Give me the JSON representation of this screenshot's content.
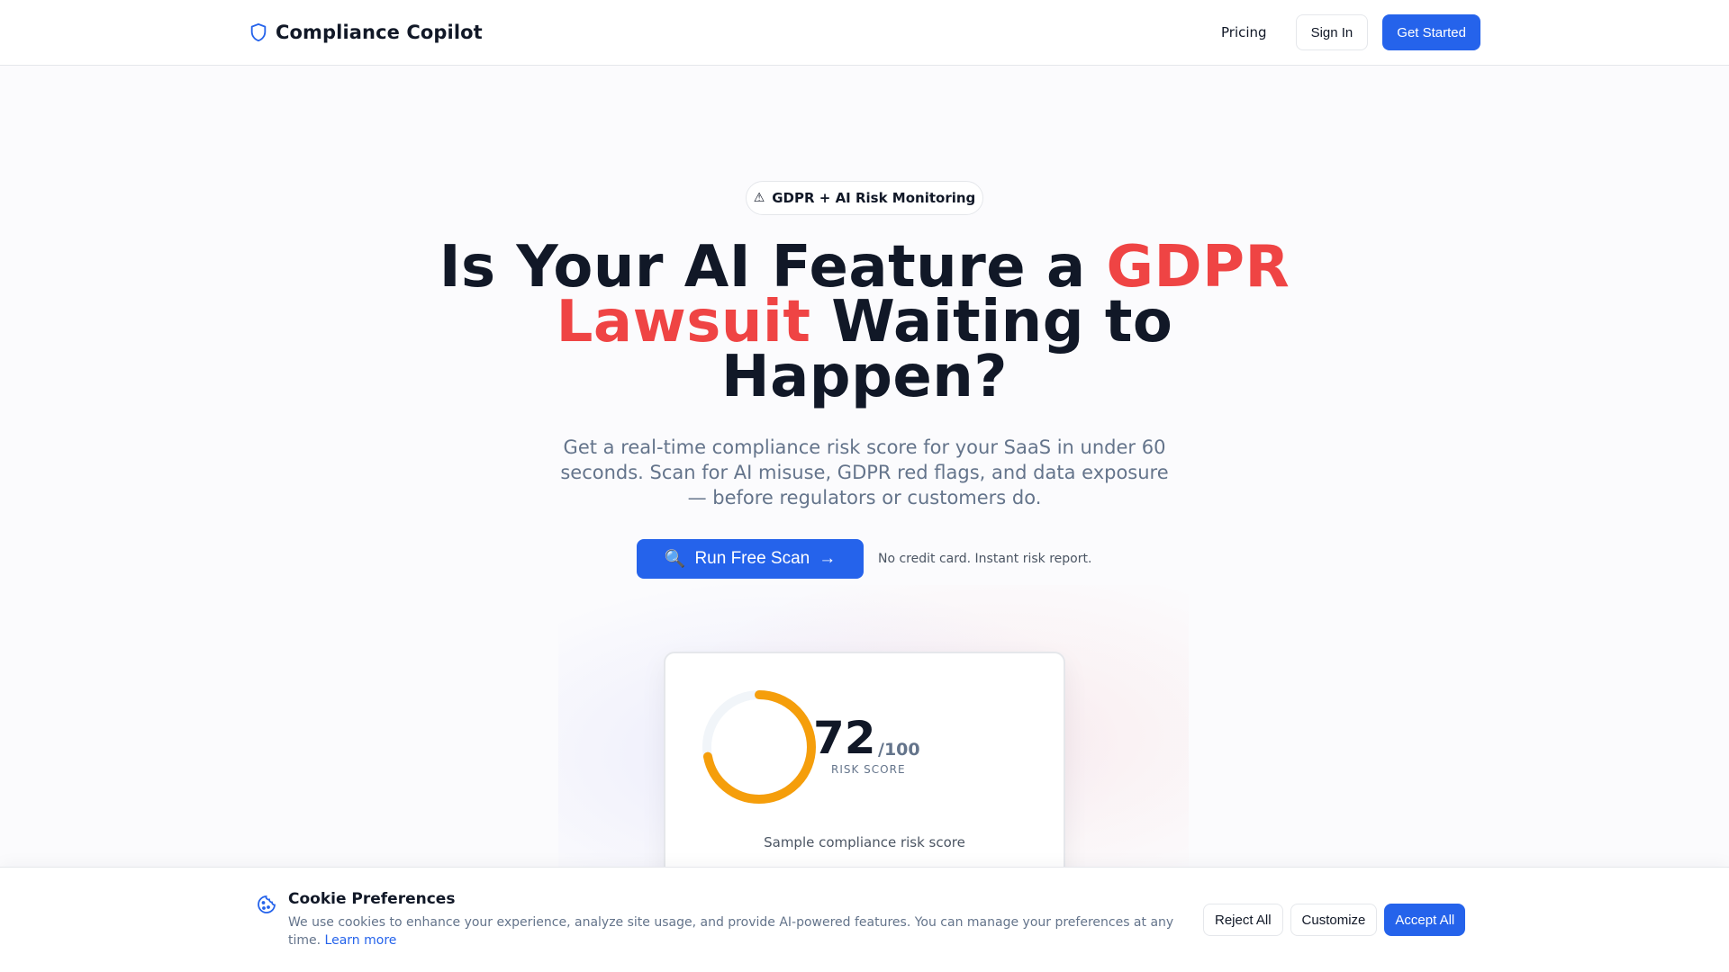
{
  "header": {
    "brand_name": "Compliance Copilot",
    "brand_icon": "shield-icon",
    "nav": {
      "pricing": "Pricing",
      "sign_in": "Sign In",
      "get_started": "Get Started"
    }
  },
  "hero": {
    "badge_icon": "⚠",
    "badge_text": "GDPR + AI Risk Monitoring",
    "headline_part1": "Is Your AI Feature a ",
    "headline_accent": "GDPR Lawsuit",
    "headline_part2": " Waiting to Happen?",
    "subtext": "Get a real-time compliance risk score for your SaaS in under 60 seconds. Scan for AI misuse, GDPR red flags, and data exposure — before regulators or customers do.",
    "cta_icon": "🔍",
    "cta_label": "Run Free Scan",
    "cta_arrow": "→",
    "cta_note": "No credit card. Instant risk report."
  },
  "score_card": {
    "score": "72",
    "max": "/100",
    "label": "RISK SCORE",
    "caption": "Sample compliance risk score",
    "score_fraction": 0.72,
    "gauge_color": "#f59e0b",
    "track_color": "#f1f5f9"
  },
  "cookie": {
    "title": "Cookie Preferences",
    "text": "We use cookies to enhance your experience, analyze site usage, and provide AI-powered features. You can manage your preferences at any time.",
    "learn_more": "Learn more",
    "reject": "Reject All",
    "customize": "Customize",
    "accept": "Accept All"
  },
  "colors": {
    "primary": "#2563eb",
    "accent": "#ef4444",
    "text": "#111827",
    "muted": "#64748b"
  }
}
